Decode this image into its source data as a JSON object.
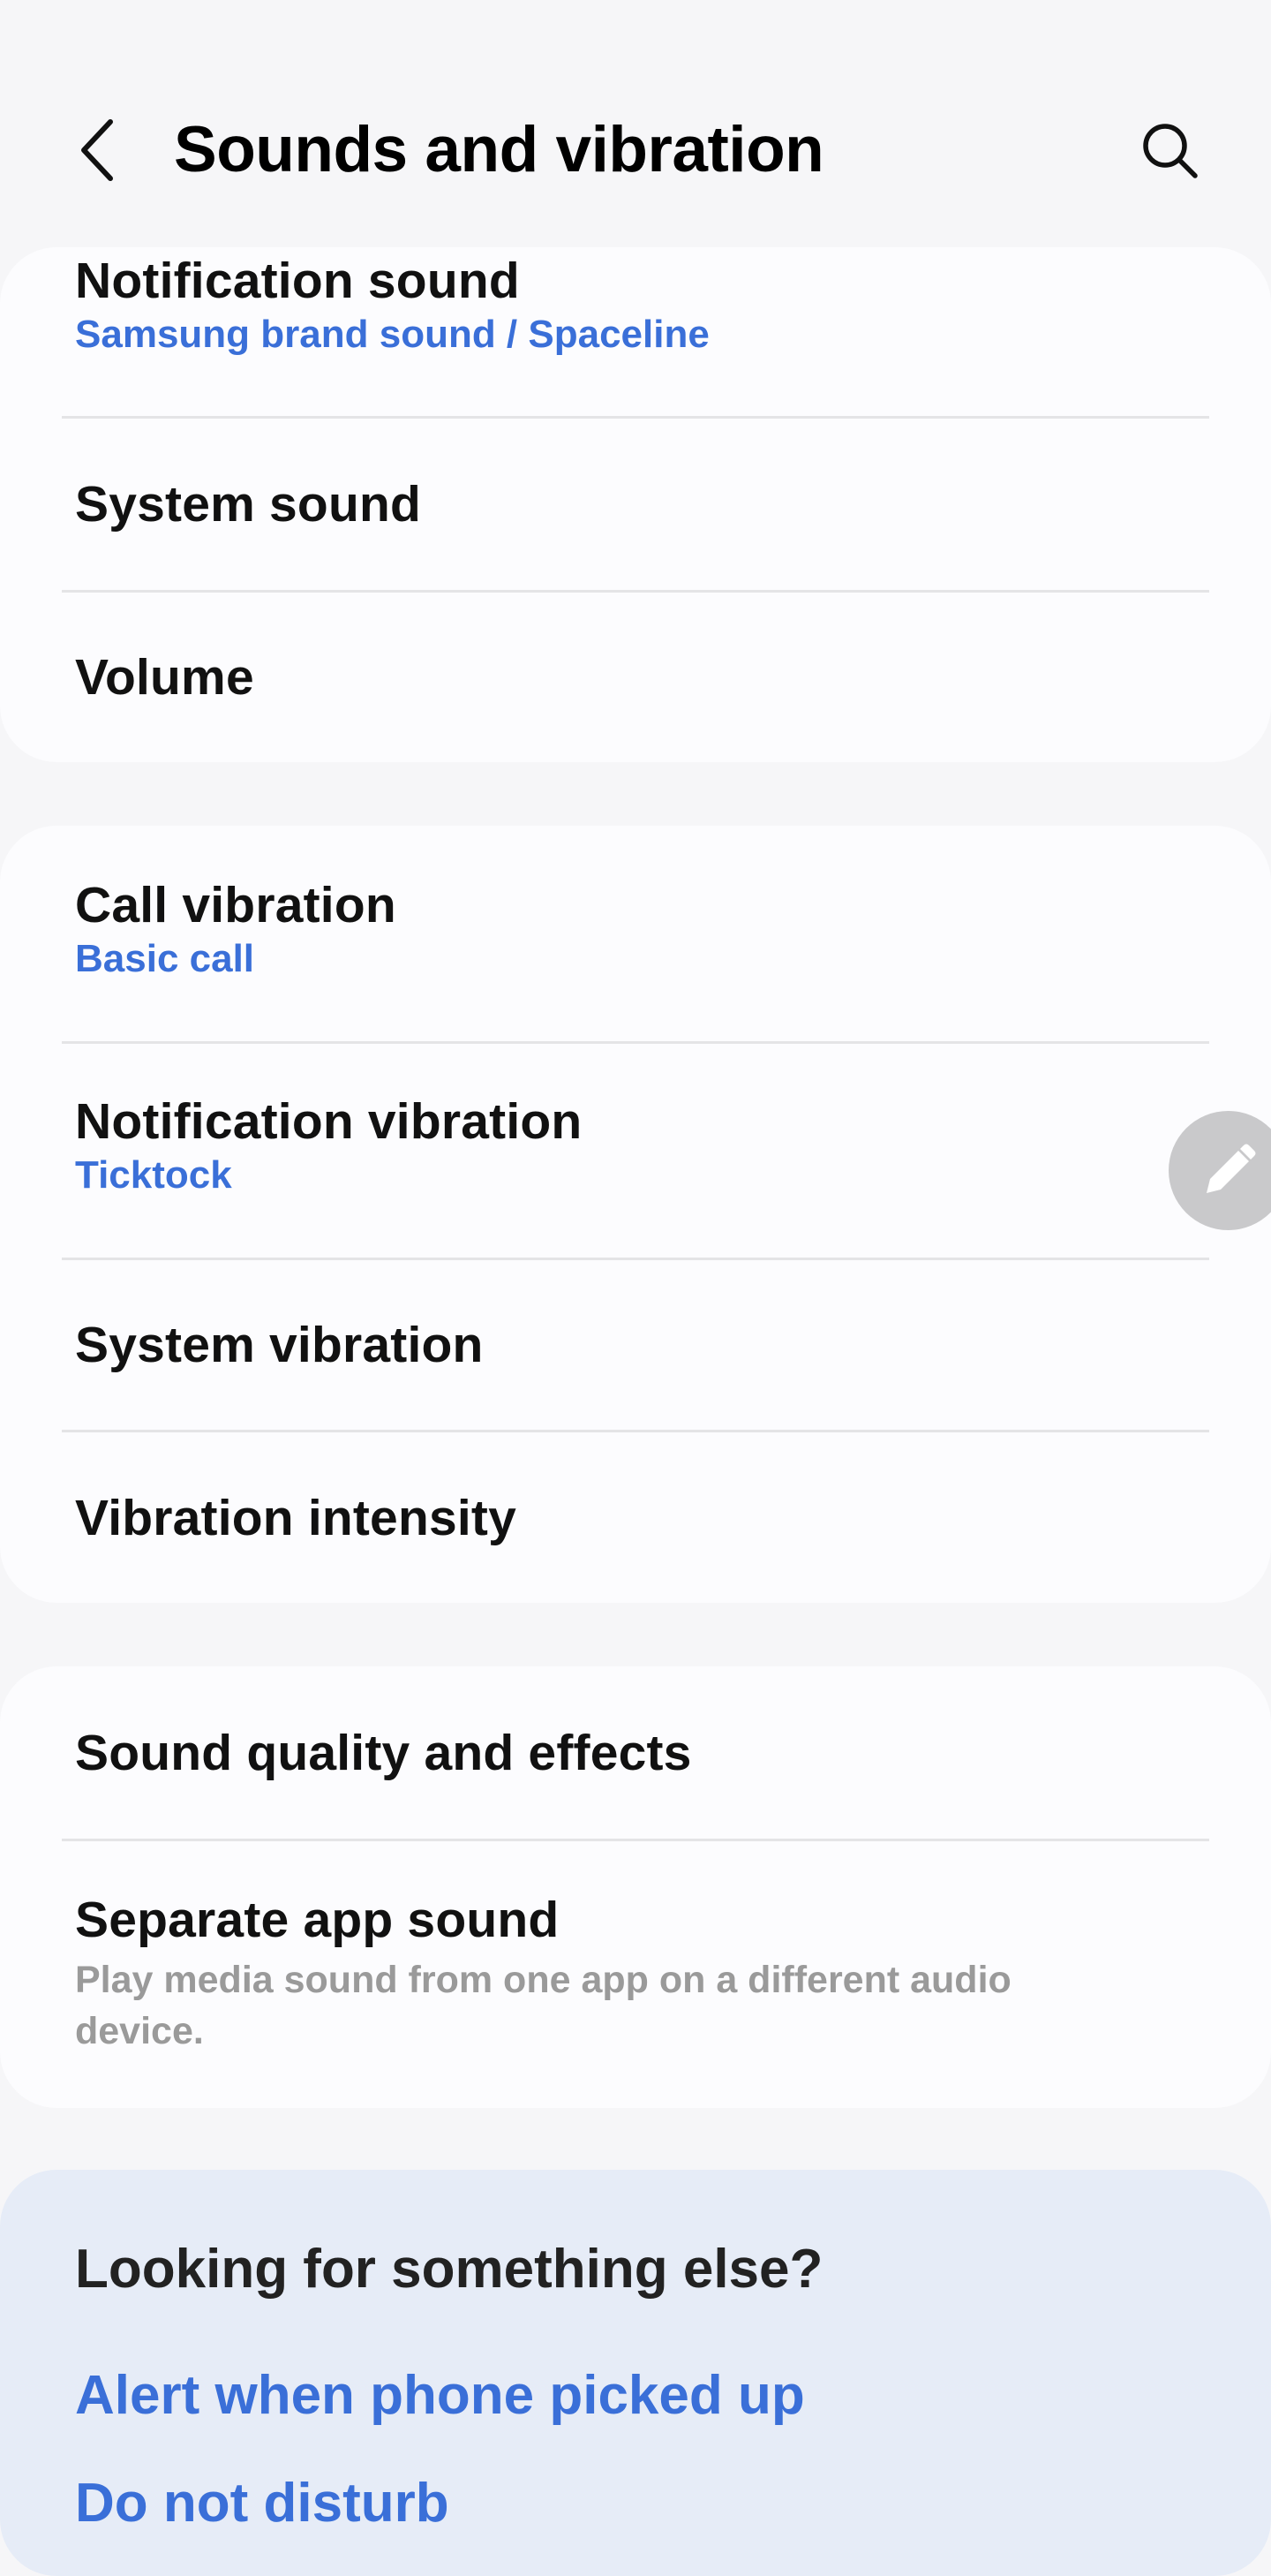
{
  "header": {
    "title": "Sounds and vibration",
    "back_icon": "chevron-left-icon",
    "search_icon": "search-icon"
  },
  "group_sound": {
    "items": [
      {
        "title": "Notification sound",
        "subtitle": "Samsung brand sound / Spaceline"
      },
      {
        "title": "System sound"
      },
      {
        "title": "Volume"
      }
    ]
  },
  "group_vibration": {
    "items": [
      {
        "title": "Call vibration",
        "subtitle": "Basic call"
      },
      {
        "title": "Notification vibration",
        "subtitle": "Ticktock"
      },
      {
        "title": "System vibration"
      },
      {
        "title": "Vibration intensity"
      }
    ]
  },
  "group_quality": {
    "items": [
      {
        "title": "Sound quality and effects"
      },
      {
        "title": "Separate app sound",
        "description": "Play media sound from one app on a different audio device."
      }
    ]
  },
  "edit_button": {
    "icon": "pencil-icon"
  },
  "looking": {
    "title": "Looking for something else?",
    "links": [
      "Alert when phone picked up",
      "Do not disturb"
    ]
  },
  "colors": {
    "background": "#f6f6f8",
    "card": "#fcfcfe",
    "accent": "#3a6fd8",
    "secondary_text": "#9a9a9a",
    "suggestion_card": "#e6ecf7"
  }
}
